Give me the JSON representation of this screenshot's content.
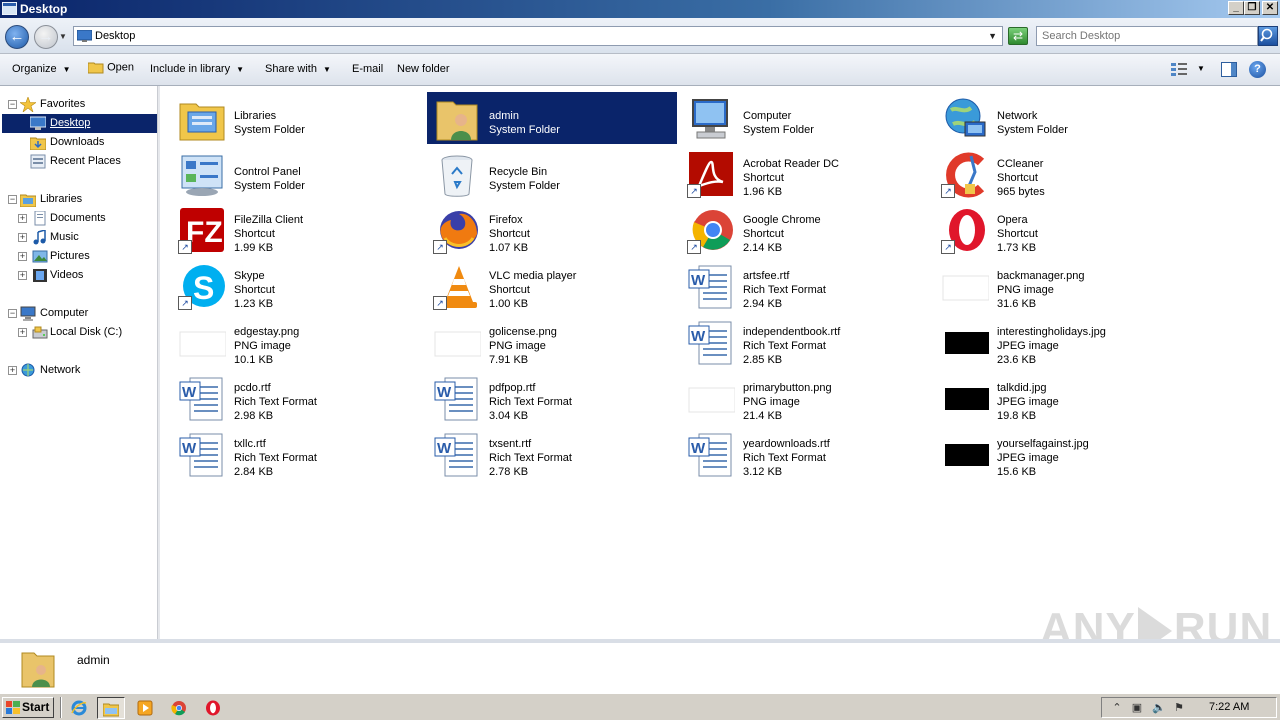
{
  "window": {
    "title": "Desktop"
  },
  "address": {
    "path": "Desktop"
  },
  "search": {
    "placeholder": "Search Desktop"
  },
  "commands": {
    "organize": "Organize",
    "open": "Open",
    "include_in_library": "Include in library",
    "share_with": "Share with",
    "email": "E-mail",
    "new_folder": "New folder"
  },
  "nav": {
    "favorites": "Favorites",
    "desktop": "Desktop",
    "downloads": "Downloads",
    "recent_places": "Recent Places",
    "libraries": "Libraries",
    "documents": "Documents",
    "music": "Music",
    "pictures": "Pictures",
    "videos": "Videos",
    "computer": "Computer",
    "local_disk": "Local Disk (C:)",
    "network": "Network"
  },
  "items": [
    {
      "name": "Libraries",
      "type": "System Folder",
      "size": "",
      "icon": "libraries-icon"
    },
    {
      "name": "admin",
      "type": "System Folder",
      "size": "",
      "icon": "user-folder-icon",
      "selected": true
    },
    {
      "name": "Computer",
      "type": "System Folder",
      "size": "",
      "icon": "computer-icon"
    },
    {
      "name": "Network",
      "type": "System Folder",
      "size": "",
      "icon": "network-icon"
    },
    {
      "name": "Control Panel",
      "type": "System Folder",
      "size": "",
      "icon": "control-panel-icon"
    },
    {
      "name": "Recycle Bin",
      "type": "System Folder",
      "size": "",
      "icon": "recycle-bin-icon"
    },
    {
      "name": "Acrobat Reader DC",
      "type": "Shortcut",
      "size": "1.96 KB",
      "icon": "acrobat-icon"
    },
    {
      "name": "CCleaner",
      "type": "Shortcut",
      "size": "965 bytes",
      "icon": "ccleaner-icon"
    },
    {
      "name": "FileZilla Client",
      "type": "Shortcut",
      "size": "1.99 KB",
      "icon": "filezilla-icon"
    },
    {
      "name": "Firefox",
      "type": "Shortcut",
      "size": "1.07 KB",
      "icon": "firefox-icon"
    },
    {
      "name": "Google Chrome",
      "type": "Shortcut",
      "size": "2.14 KB",
      "icon": "chrome-icon"
    },
    {
      "name": "Opera",
      "type": "Shortcut",
      "size": "1.73 KB",
      "icon": "opera-icon"
    },
    {
      "name": "Skype",
      "type": "Shortcut",
      "size": "1.23 KB",
      "icon": "skype-icon"
    },
    {
      "name": "VLC media player",
      "type": "Shortcut",
      "size": "1.00 KB",
      "icon": "vlc-icon"
    },
    {
      "name": "artsfee.rtf",
      "type": "Rich Text Format",
      "size": "2.94 KB",
      "icon": "word-document-icon"
    },
    {
      "name": "backmanager.png",
      "type": "PNG image",
      "size": "31.6 KB",
      "icon": "png-thumbnail-icon"
    },
    {
      "name": "edgestay.png",
      "type": "PNG image",
      "size": "10.1 KB",
      "icon": "png-thumbnail-icon"
    },
    {
      "name": "golicense.png",
      "type": "PNG image",
      "size": "7.91 KB",
      "icon": "png-thumbnail-icon"
    },
    {
      "name": "independentbook.rtf",
      "type": "Rich Text Format",
      "size": "2.85 KB",
      "icon": "word-document-icon"
    },
    {
      "name": "interestingholidays.jpg",
      "type": "JPEG image",
      "size": "23.6 KB",
      "icon": "jpeg-thumbnail-icon"
    },
    {
      "name": "pcdo.rtf",
      "type": "Rich Text Format",
      "size": "2.98 KB",
      "icon": "word-document-icon"
    },
    {
      "name": "pdfpop.rtf",
      "type": "Rich Text Format",
      "size": "3.04 KB",
      "icon": "word-document-icon"
    },
    {
      "name": "primarybutton.png",
      "type": "PNG image",
      "size": "21.4 KB",
      "icon": "png-thumbnail-icon"
    },
    {
      "name": "talkdid.jpg",
      "type": "JPEG image",
      "size": "19.8 KB",
      "icon": "jpeg-thumbnail-icon"
    },
    {
      "name": "txllc.rtf",
      "type": "Rich Text Format",
      "size": "2.84 KB",
      "icon": "word-document-icon"
    },
    {
      "name": "txsent.rtf",
      "type": "Rich Text Format",
      "size": "2.78 KB",
      "icon": "word-document-icon"
    },
    {
      "name": "yeardownloads.rtf",
      "type": "Rich Text Format",
      "size": "3.12 KB",
      "icon": "word-document-icon"
    },
    {
      "name": "yourselfagainst.jpg",
      "type": "JPEG image",
      "size": "15.6 KB",
      "icon": "jpeg-thumbnail-icon"
    }
  ],
  "details": {
    "name": "admin"
  },
  "watermark": {
    "left": "ANY",
    "right": "RUN"
  },
  "taskbar": {
    "start": "Start",
    "clock": "7:22 AM",
    "apps": [
      "internet-explorer-icon",
      "explorer-icon",
      "media-player-icon",
      "chrome-icon",
      "opera-icon"
    ]
  },
  "colors": {
    "selection": "#0a246a",
    "titlebar": "#0a246a",
    "taskbar": "#d4d0c8"
  }
}
